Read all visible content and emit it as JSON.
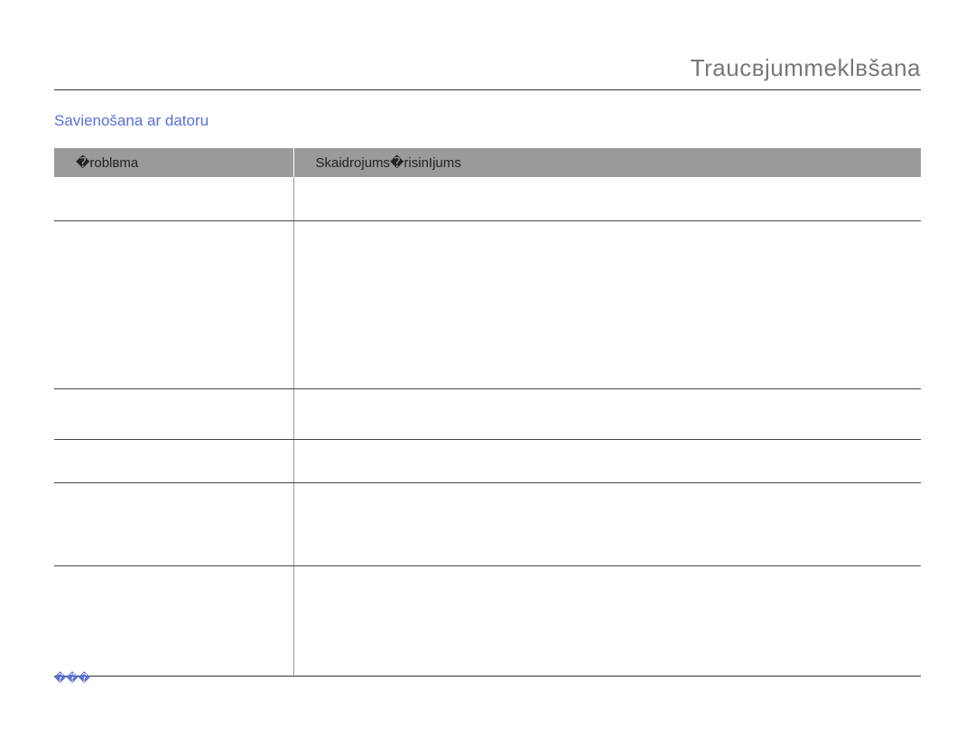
{
  "page_title": "Traucвjummeklвšana",
  "section_title": "Savienošana ar datoru",
  "table": {
    "headers": [
      "�roblвma",
      "Skaidrojums�risinІjums"
    ]
  },
  "page_number": "���"
}
